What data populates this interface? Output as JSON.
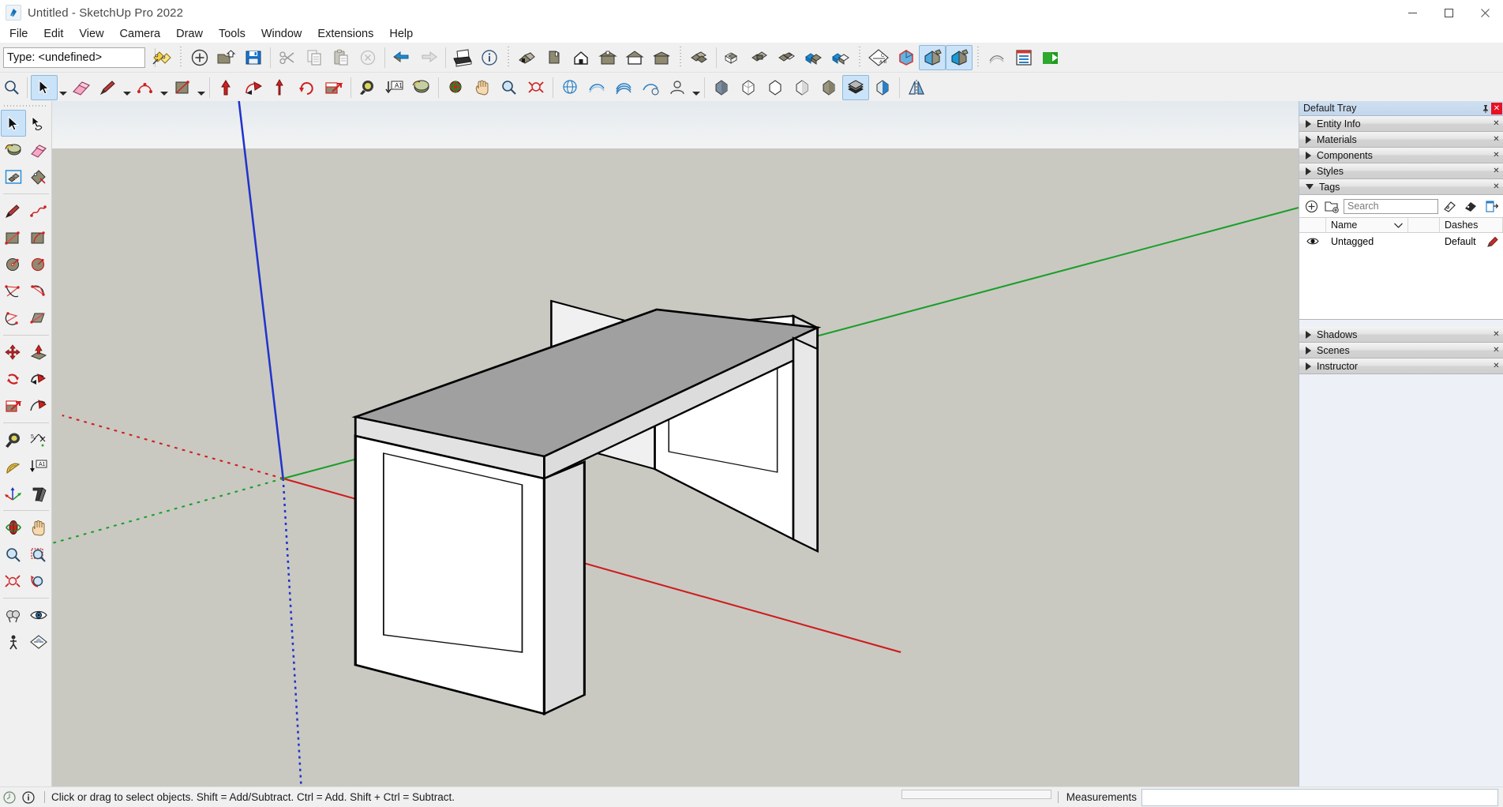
{
  "window": {
    "title": "Untitled - SketchUp Pro 2022",
    "app_icon": "sketchup-logo-icon",
    "controls": {
      "minimize": "─",
      "maximize": "☐",
      "close": "✕"
    }
  },
  "menubar": {
    "items": [
      "File",
      "Edit",
      "View",
      "Camera",
      "Draw",
      "Tools",
      "Window",
      "Extensions",
      "Help"
    ]
  },
  "toolbar_top": {
    "type_combo": {
      "label": "Type:",
      "value": "Type: <undefined>",
      "placeholder": "Type: <undefined>"
    },
    "groups": [
      {
        "name": "tag-tools",
        "buttons": [
          {
            "icon": "tag-paint-icon",
            "label": "Tag Tool"
          }
        ]
      },
      {
        "name": "standard",
        "buttons": [
          {
            "icon": "new-document-icon",
            "label": "New"
          },
          {
            "icon": "open-folder-icon",
            "label": "Open"
          },
          {
            "icon": "save-disk-icon",
            "label": "Save"
          }
        ]
      },
      {
        "name": "edit",
        "buttons": [
          {
            "icon": "scissors-cut-icon",
            "label": "Cut"
          },
          {
            "icon": "copy-icon",
            "label": "Copy"
          },
          {
            "icon": "paste-clipboard-icon",
            "label": "Paste"
          },
          {
            "icon": "erase-circle-icon",
            "label": "Erase"
          }
        ]
      },
      {
        "name": "undo",
        "buttons": [
          {
            "icon": "undo-arrow-icon",
            "label": "Undo"
          },
          {
            "icon": "redo-arrow-icon",
            "label": "Redo"
          }
        ]
      },
      {
        "name": "print-info",
        "buttons": [
          {
            "icon": "printer-icon",
            "label": "Print"
          },
          {
            "icon": "model-info-icon",
            "label": "Model Info"
          }
        ]
      },
      {
        "name": "views",
        "buttons": [
          {
            "icon": "iso-view-icon",
            "label": "Iso"
          },
          {
            "icon": "top-view-icon",
            "label": "Top"
          },
          {
            "icon": "front-view-icon",
            "label": "Front"
          },
          {
            "icon": "right-view-icon",
            "label": "Right"
          },
          {
            "icon": "back-view-icon",
            "label": "Back"
          },
          {
            "icon": "left-view-icon",
            "label": "Left"
          }
        ]
      },
      {
        "name": "solid-tools",
        "buttons": [
          {
            "icon": "solid-outer-shell-icon",
            "label": "Outer Shell"
          },
          {
            "icon": "solid-intersect-icon",
            "label": "Intersect"
          },
          {
            "icon": "solid-union-icon",
            "label": "Union"
          },
          {
            "icon": "solid-subtract-icon",
            "label": "Subtract"
          },
          {
            "icon": "solid-trim-icon",
            "label": "Trim"
          },
          {
            "icon": "solid-split-icon",
            "label": "Split"
          }
        ]
      },
      {
        "name": "sections-styles",
        "buttons": [
          {
            "icon": "section-plane-icon",
            "label": "Section Plane"
          },
          {
            "icon": "xray-face-style-icon",
            "label": "X-ray"
          },
          {
            "icon": "shaded-style-icon",
            "label": "Shaded",
            "state": "active"
          },
          {
            "icon": "shaded-texture-style-icon",
            "label": "Shaded With Textures"
          }
        ]
      },
      {
        "name": "extensions",
        "buttons": [
          {
            "icon": "sandbox-smoove-icon",
            "label": "Smoove"
          },
          {
            "icon": "layout-send-icon",
            "label": "Send to LayOut"
          },
          {
            "icon": "extension-warehouse-icon",
            "label": "Extension Warehouse"
          }
        ]
      }
    ]
  },
  "toolbar_second": {
    "buttons": [
      {
        "icon": "zoom-magnifier-icon",
        "label": "Zoom"
      },
      {
        "icon": "select-arrow-icon",
        "label": "Select",
        "state": "active",
        "has_dropdown": true
      },
      {
        "icon": "eraser-icon",
        "label": "Eraser"
      },
      {
        "icon": "line-pencil-icon",
        "label": "Line",
        "has_dropdown": true
      },
      {
        "icon": "arc-icon",
        "label": "Arc",
        "has_dropdown": true
      },
      {
        "icon": "rectangle-icon",
        "label": "Rectangle",
        "has_dropdown": true
      },
      {
        "icon": "push-pull-icon",
        "label": "Push/Pull"
      },
      {
        "icon": "follow-me-icon",
        "label": "Follow Me"
      },
      {
        "icon": "move-icon",
        "label": "Move"
      },
      {
        "icon": "rotate-icon",
        "label": "Rotate"
      },
      {
        "icon": "scale-icon",
        "label": "Scale"
      },
      {
        "icon": "tape-measure-icon",
        "label": "Tape Measure"
      },
      {
        "icon": "text-label-icon",
        "label": "Text"
      },
      {
        "icon": "paint-bucket-icon",
        "label": "Paint Bucket"
      },
      {
        "icon": "orbit-icon",
        "label": "Orbit"
      },
      {
        "icon": "pan-hand-icon",
        "label": "Pan"
      },
      {
        "icon": "zoom-tool-icon",
        "label": "Zoom"
      },
      {
        "icon": "zoom-extents-icon",
        "label": "Zoom Extents"
      },
      {
        "icon": "position-camera-icon",
        "label": "Position Camera"
      },
      {
        "icon": "walk-icon",
        "label": "Walk"
      },
      {
        "icon": "look-around-icon",
        "label": "Look Around"
      },
      {
        "icon": "section-plane-tool-icon",
        "label": "Section Plane"
      },
      {
        "icon": "add-location-icon",
        "label": "Add Location",
        "has_dropdown": true
      },
      {
        "icon": "style-front-icon",
        "label": "Front Style"
      },
      {
        "icon": "style-wireframe-icon",
        "label": "Wireframe"
      },
      {
        "icon": "style-hidden-line-icon",
        "label": "Hidden Line"
      },
      {
        "icon": "style-shaded-icon",
        "label": "Shaded"
      },
      {
        "icon": "style-monochrome-icon",
        "label": "Monochrome"
      },
      {
        "icon": "style-texture-icon",
        "label": "Shaded With Textures",
        "state": "active"
      },
      {
        "icon": "style-xray-icon",
        "label": "X-ray"
      },
      {
        "icon": "mirror-icon",
        "label": "Mirror"
      }
    ]
  },
  "left_toolbar": {
    "buttons": [
      {
        "icon": "select-arrow-icon",
        "label": "Select",
        "state": "active"
      },
      {
        "icon": "lasso-select-icon",
        "label": "Lasso Select"
      },
      {
        "icon": "paint-bucket-icon",
        "label": "Paint Bucket"
      },
      {
        "icon": "eraser-icon",
        "label": "Eraser"
      },
      {
        "icon": "make-component-icon",
        "label": "Make Component"
      },
      {
        "icon": "tag-tool-icon",
        "label": "Tag Tool"
      },
      {
        "icon": "line-pencil-icon",
        "label": "Line"
      },
      {
        "icon": "freehand-icon",
        "label": "Freehand"
      },
      {
        "icon": "rectangle-icon",
        "label": "Rectangle"
      },
      {
        "icon": "rotated-rectangle-icon",
        "label": "Rotated Rectangle"
      },
      {
        "icon": "circle-icon",
        "label": "Circle"
      },
      {
        "icon": "polygon-icon",
        "label": "Polygon"
      },
      {
        "icon": "arc-2point-icon",
        "label": "2 Point Arc"
      },
      {
        "icon": "arc-pie-icon",
        "label": "Pie"
      },
      {
        "icon": "arc-3point-icon",
        "label": "3 Point Arc"
      },
      {
        "icon": "sandbox-from-scratch-icon",
        "label": "From Scratch"
      },
      {
        "icon": "move-icon",
        "label": "Move"
      },
      {
        "icon": "push-pull-icon",
        "label": "Push/Pull"
      },
      {
        "icon": "rotate-icon",
        "label": "Rotate"
      },
      {
        "icon": "follow-me-icon",
        "label": "Follow Me"
      },
      {
        "icon": "scale-icon",
        "label": "Scale"
      },
      {
        "icon": "offset-icon",
        "label": "Offset"
      },
      {
        "icon": "tape-measure-icon",
        "label": "Tape Measure"
      },
      {
        "icon": "dimension-icon",
        "label": "Dimensions"
      },
      {
        "icon": "protractor-icon",
        "label": "Protractor"
      },
      {
        "icon": "text-label-icon",
        "label": "Text"
      },
      {
        "icon": "axes-icon",
        "label": "Axes"
      },
      {
        "icon": "3d-text-icon",
        "label": "3D Text"
      },
      {
        "icon": "orbit-icon",
        "label": "Orbit"
      },
      {
        "icon": "pan-hand-icon",
        "label": "Pan"
      },
      {
        "icon": "zoom-tool-icon",
        "label": "Zoom"
      },
      {
        "icon": "zoom-window-icon",
        "label": "Zoom Window"
      },
      {
        "icon": "zoom-extents-icon",
        "label": "Zoom Extents"
      },
      {
        "icon": "previous-view-icon",
        "label": "Previous"
      },
      {
        "icon": "position-camera-icon",
        "label": "Position Camera"
      },
      {
        "icon": "look-around-icon",
        "label": "Look Around"
      },
      {
        "icon": "walk-icon",
        "label": "Walk"
      },
      {
        "icon": "section-plane-tool-icon",
        "label": "Section Plane"
      }
    ]
  },
  "tray": {
    "title": "Default Tray",
    "pin": "pin-icon",
    "close": "✕",
    "panels": [
      {
        "label": "Entity Info",
        "expanded": false
      },
      {
        "label": "Materials",
        "expanded": false
      },
      {
        "label": "Components",
        "expanded": false
      },
      {
        "label": "Styles",
        "expanded": false
      },
      {
        "label": "Tags",
        "expanded": true
      }
    ],
    "panels_lower": [
      {
        "label": "Shadows",
        "expanded": false
      },
      {
        "label": "Scenes",
        "expanded": false
      },
      {
        "label": "Instructor",
        "expanded": false
      }
    ],
    "tags": {
      "toolbar": [
        {
          "icon": "add-tag-icon",
          "label": "Add Tag"
        },
        {
          "icon": "add-tag-folder-icon",
          "label": "Add Tag Folder"
        },
        {
          "icon": "tag-select-icon",
          "label": "Select All"
        },
        {
          "icon": "tag-color-icon",
          "label": "Tag Color"
        },
        {
          "icon": "tag-details-icon",
          "label": "Details"
        }
      ],
      "search_placeholder": "Search",
      "search_value": "",
      "columns": [
        "",
        "Name",
        "",
        "Dashes",
        ""
      ],
      "rows": [
        {
          "visible_icon": "eye-icon",
          "name": "Untagged",
          "dashes": "Default",
          "pencil_icon": "pencil-icon"
        }
      ]
    }
  },
  "statusbar": {
    "help_icon": "help-circle-icon",
    "info_icon": "info-circle-icon",
    "message": "Click or drag to select objects. Shift = Add/Subtract. Ctrl = Add. Shift + Ctrl = Subtract.",
    "measurements_label": "Measurements",
    "measurements_value": ""
  },
  "viewport": {
    "sky_color": "#eef1f3",
    "ground_color": "#c9c9c2",
    "axis_red": "#cf1c1c",
    "axis_green": "#1a9e29",
    "axis_blue": "#2233cc",
    "model": {
      "name": "desk-table-model",
      "top_face_color": "#a0a0a0",
      "front_face_color": "#ffffff",
      "side_face_color": "#dcdcdc",
      "edge_color": "#000000"
    }
  }
}
